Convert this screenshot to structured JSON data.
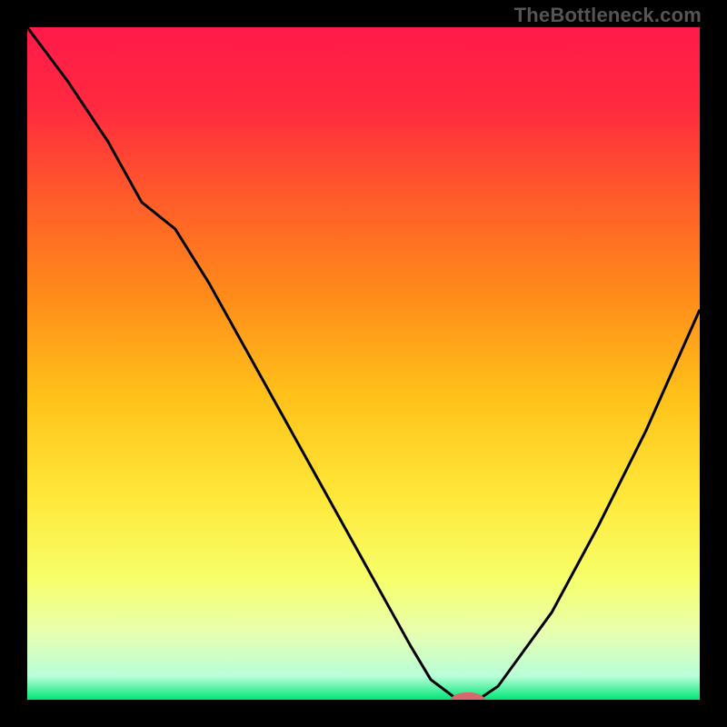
{
  "watermark": "TheBottleneck.com",
  "colors": {
    "bg": "#000000",
    "gradient_stops": [
      {
        "offset": 0.0,
        "color": "#ff1a4a"
      },
      {
        "offset": 0.12,
        "color": "#ff2a3f"
      },
      {
        "offset": 0.25,
        "color": "#ff5a2a"
      },
      {
        "offset": 0.4,
        "color": "#ff8c1a"
      },
      {
        "offset": 0.55,
        "color": "#ffc21a"
      },
      {
        "offset": 0.7,
        "color": "#ffe83a"
      },
      {
        "offset": 0.82,
        "color": "#f7ff6a"
      },
      {
        "offset": 0.9,
        "color": "#e8ffb0"
      },
      {
        "offset": 0.965,
        "color": "#b8ffd8"
      },
      {
        "offset": 1.0,
        "color": "#00e676"
      }
    ],
    "curve": "#000000",
    "marker_fill": "#d66a6a",
    "marker_stroke": "#ffffff"
  },
  "chart_data": {
    "type": "line",
    "title": "",
    "xlabel": "",
    "ylabel": "",
    "xlim": [
      0,
      100
    ],
    "ylim": [
      0,
      100
    ],
    "series": [
      {
        "name": "bottleneck-curve",
        "x": [
          0,
          6,
          12,
          17,
          22,
          27,
          32,
          37,
          42,
          47,
          52,
          57,
          60,
          64,
          67,
          70,
          78,
          85,
          92,
          100
        ],
        "y": [
          100,
          92,
          83,
          74,
          70,
          62,
          53,
          44,
          35,
          26,
          17,
          8,
          3,
          0,
          0,
          2,
          13,
          26,
          40,
          58
        ]
      }
    ],
    "marker": {
      "x": 65.5,
      "y": 0,
      "rx": 2.5,
      "ry": 1.1
    }
  }
}
